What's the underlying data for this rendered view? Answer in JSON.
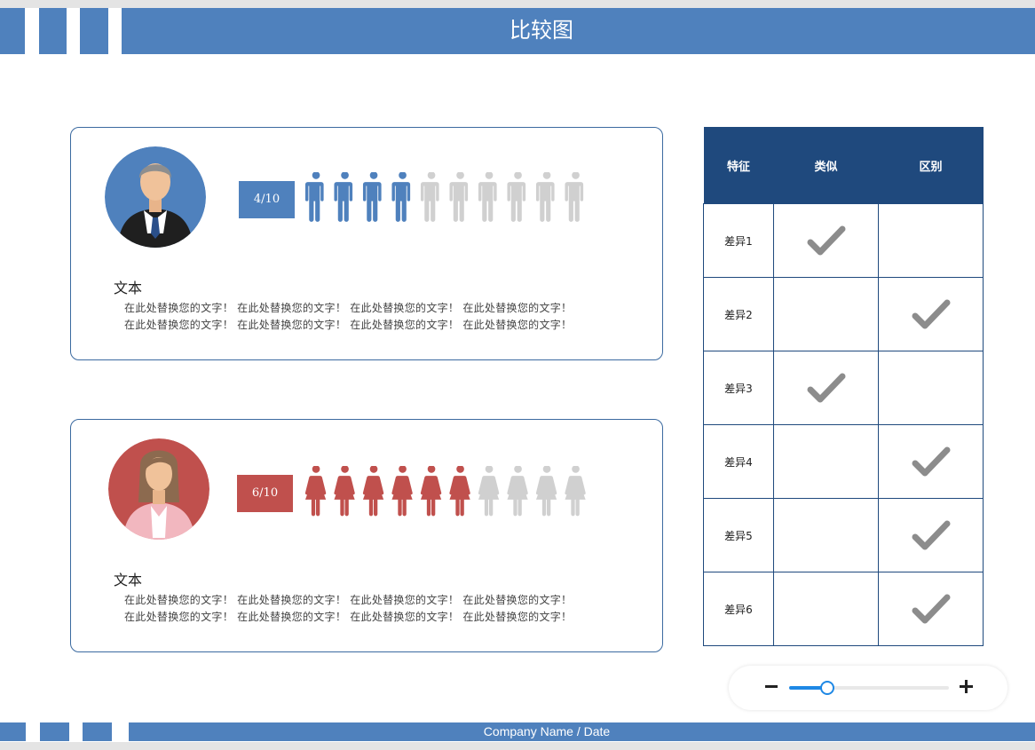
{
  "header": {
    "title": "比较图"
  },
  "footer": {
    "text": "Company Name / Date"
  },
  "cards": [
    {
      "ratio_label": "4/10",
      "filled": 4,
      "total": 10,
      "figure": "male-figure-icon",
      "color": "#4f81bd",
      "heading": "文本",
      "body_line1": "在此处替换您的文字！ 在此处替换您的文字！ 在此处替换您的文字！ 在此处替换您的文字！",
      "body_line2": "在此处替换您的文字！ 在此处替换您的文字！ 在此处替换您的文字！ 在此处替换您的文字！"
    },
    {
      "ratio_label": "6/10",
      "filled": 6,
      "total": 10,
      "figure": "female-figure-icon",
      "color": "#c0504d",
      "heading": "文本",
      "body_line1": "在此处替换您的文字！ 在此处替换您的文字！ 在此处替换您的文字！ 在此处替换您的文字！",
      "body_line2": "在此处替换您的文字！ 在此处替换您的文字！ 在此处替换您的文字！ 在此处替换您的文字！"
    }
  ],
  "table": {
    "headers": [
      "特征",
      "类似",
      "区别"
    ],
    "rows": [
      {
        "label": "差异1",
        "similar": true,
        "different": false
      },
      {
        "label": "差异2",
        "similar": false,
        "different": true
      },
      {
        "label": "差异3",
        "similar": true,
        "different": false
      },
      {
        "label": "差异4",
        "similar": false,
        "different": true
      },
      {
        "label": "差异5",
        "similar": false,
        "different": true
      },
      {
        "label": "差异6",
        "similar": false,
        "different": true
      }
    ]
  },
  "zoom": {
    "level": 0.24,
    "minus_icon": "minus-icon",
    "plus_icon": "plus-icon"
  },
  "colors": {
    "brand": "#4f81bd",
    "table_header": "#1f497d",
    "inactive": "#d0d0d0",
    "check": "#8c8c8c"
  }
}
